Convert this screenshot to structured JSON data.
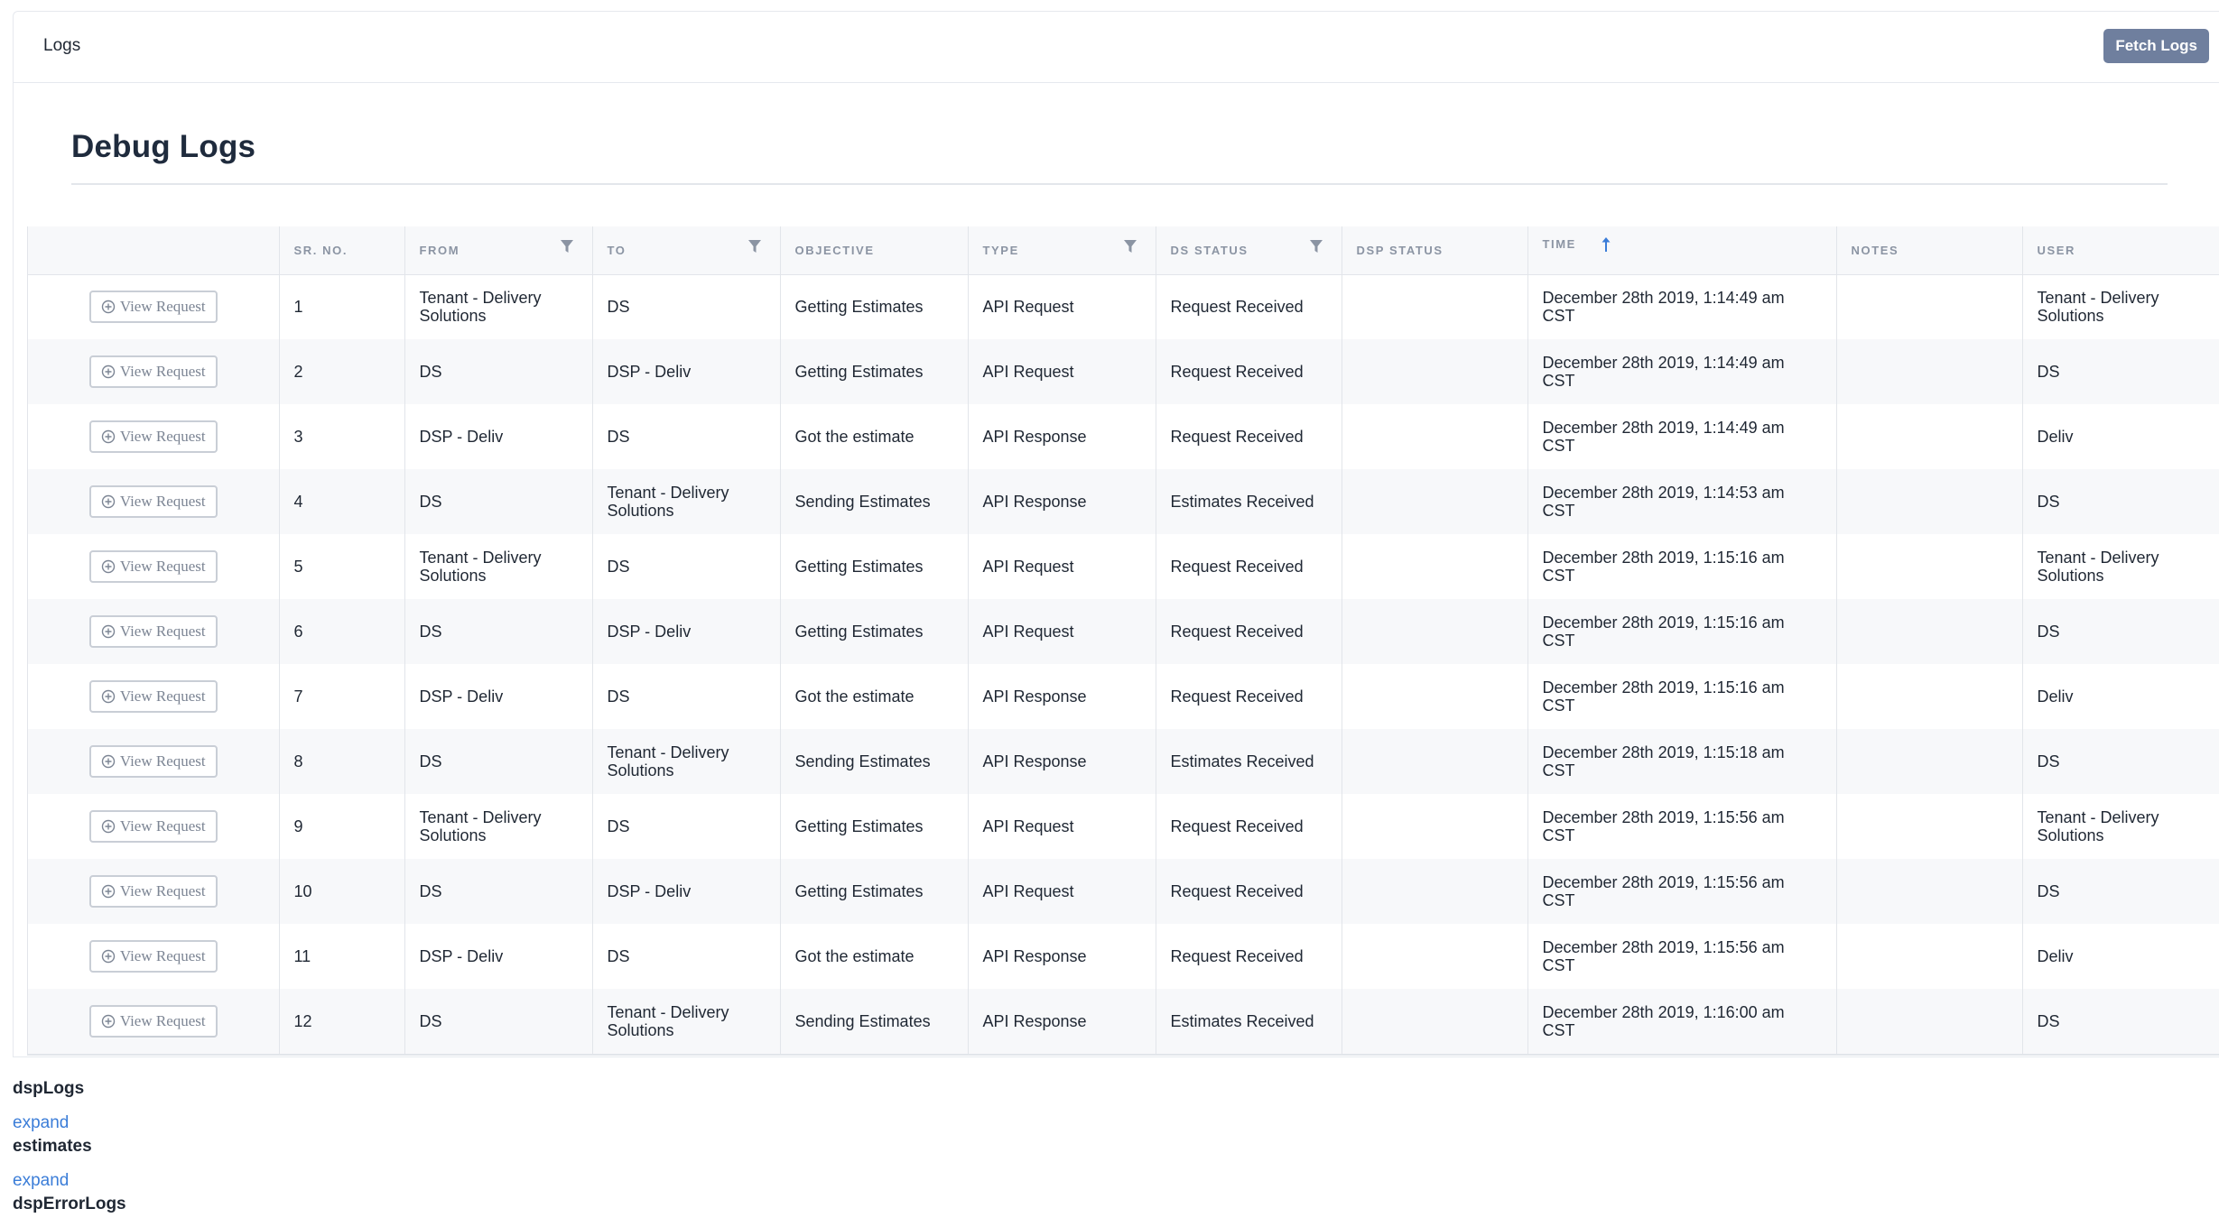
{
  "breadcrumb": "Logs",
  "fetch_button": "Fetch Logs",
  "page_title": "Debug Logs",
  "table": {
    "columns": {
      "action": "",
      "sr_no": "SR. NO.",
      "from": "FROM",
      "to": "TO",
      "objective": "OBJECTIVE",
      "type": "TYPE",
      "ds_status": "DS STATUS",
      "dsp_status": "DSP STATUS",
      "time": "TIME",
      "notes": "NOTES",
      "user": "USER"
    },
    "filterable_columns": [
      "from",
      "to",
      "type",
      "ds_status"
    ],
    "sort": {
      "column": "time",
      "direction": "ascending"
    },
    "view_button_label": "View Request",
    "rows": [
      {
        "sr_no": "1",
        "from": "Tenant - Delivery Solutions",
        "to": "DS",
        "objective": "Getting Estimates",
        "type": "API Request",
        "ds_status": "Request Received",
        "dsp_status": "",
        "time": "December 28th 2019, 1:14:49 am CST",
        "notes": "",
        "user": "Tenant - Delivery Solutions"
      },
      {
        "sr_no": "2",
        "from": "DS",
        "to": "DSP - Deliv",
        "objective": "Getting Estimates",
        "type": "API Request",
        "ds_status": "Request Received",
        "dsp_status": "",
        "time": "December 28th 2019, 1:14:49 am CST",
        "notes": "",
        "user": "DS"
      },
      {
        "sr_no": "3",
        "from": "DSP - Deliv",
        "to": "DS",
        "objective": "Got the estimate",
        "type": "API Response",
        "ds_status": "Request Received",
        "dsp_status": "",
        "time": "December 28th 2019, 1:14:49 am CST",
        "notes": "",
        "user": "Deliv"
      },
      {
        "sr_no": "4",
        "from": "DS",
        "to": "Tenant - Delivery Solutions",
        "objective": "Sending Estimates",
        "type": "API Response",
        "ds_status": "Estimates Received",
        "dsp_status": "",
        "time": "December 28th 2019, 1:14:53 am CST",
        "notes": "",
        "user": "DS"
      },
      {
        "sr_no": "5",
        "from": "Tenant - Delivery Solutions",
        "to": "DS",
        "objective": "Getting Estimates",
        "type": "API Request",
        "ds_status": "Request Received",
        "dsp_status": "",
        "time": "December 28th 2019, 1:15:16 am CST",
        "notes": "",
        "user": "Tenant - Delivery Solutions"
      },
      {
        "sr_no": "6",
        "from": "DS",
        "to": "DSP - Deliv",
        "objective": "Getting Estimates",
        "type": "API Request",
        "ds_status": "Request Received",
        "dsp_status": "",
        "time": "December 28th 2019, 1:15:16 am CST",
        "notes": "",
        "user": "DS"
      },
      {
        "sr_no": "7",
        "from": "DSP - Deliv",
        "to": "DS",
        "objective": "Got the estimate",
        "type": "API Response",
        "ds_status": "Request Received",
        "dsp_status": "",
        "time": "December 28th 2019, 1:15:16 am CST",
        "notes": "",
        "user": "Deliv"
      },
      {
        "sr_no": "8",
        "from": "DS",
        "to": "Tenant - Delivery Solutions",
        "objective": "Sending Estimates",
        "type": "API Response",
        "ds_status": "Estimates Received",
        "dsp_status": "",
        "time": "December 28th 2019, 1:15:18 am CST",
        "notes": "",
        "user": "DS"
      },
      {
        "sr_no": "9",
        "from": "Tenant - Delivery Solutions",
        "to": "DS",
        "objective": "Getting Estimates",
        "type": "API Request",
        "ds_status": "Request Received",
        "dsp_status": "",
        "time": "December 28th 2019, 1:15:56 am CST",
        "notes": "",
        "user": "Tenant - Delivery Solutions"
      },
      {
        "sr_no": "10",
        "from": "DS",
        "to": "DSP - Deliv",
        "objective": "Getting Estimates",
        "type": "API Request",
        "ds_status": "Request Received",
        "dsp_status": "",
        "time": "December 28th 2019, 1:15:56 am CST",
        "notes": "",
        "user": "DS"
      },
      {
        "sr_no": "11",
        "from": "DSP - Deliv",
        "to": "DS",
        "objective": "Got the estimate",
        "type": "API Response",
        "ds_status": "Request Received",
        "dsp_status": "",
        "time": "December 28th 2019, 1:15:56 am CST",
        "notes": "",
        "user": "Deliv"
      },
      {
        "sr_no": "12",
        "from": "DS",
        "to": "Tenant - Delivery Solutions",
        "objective": "Sending Estimates",
        "type": "API Response",
        "ds_status": "Estimates Received",
        "dsp_status": "",
        "time": "December 28th 2019, 1:16:00 am CST",
        "notes": "",
        "user": "DS"
      }
    ]
  },
  "sections": [
    {
      "title": "dspLogs",
      "link": "expand"
    },
    {
      "title": "estimates",
      "link": "expand"
    },
    {
      "title": "dspErrorLogs",
      "link": ""
    }
  ],
  "colors": {
    "accent_link": "#3b7dd8",
    "fetch_button_bg": "#6f7f9e",
    "header_bg": "#f7f8fa",
    "sort_arrow": "#3b7dd8"
  },
  "icons": {
    "filter": "filter-funnel-icon",
    "sort": "arrow-up-icon",
    "view": "plus-circle-icon"
  }
}
